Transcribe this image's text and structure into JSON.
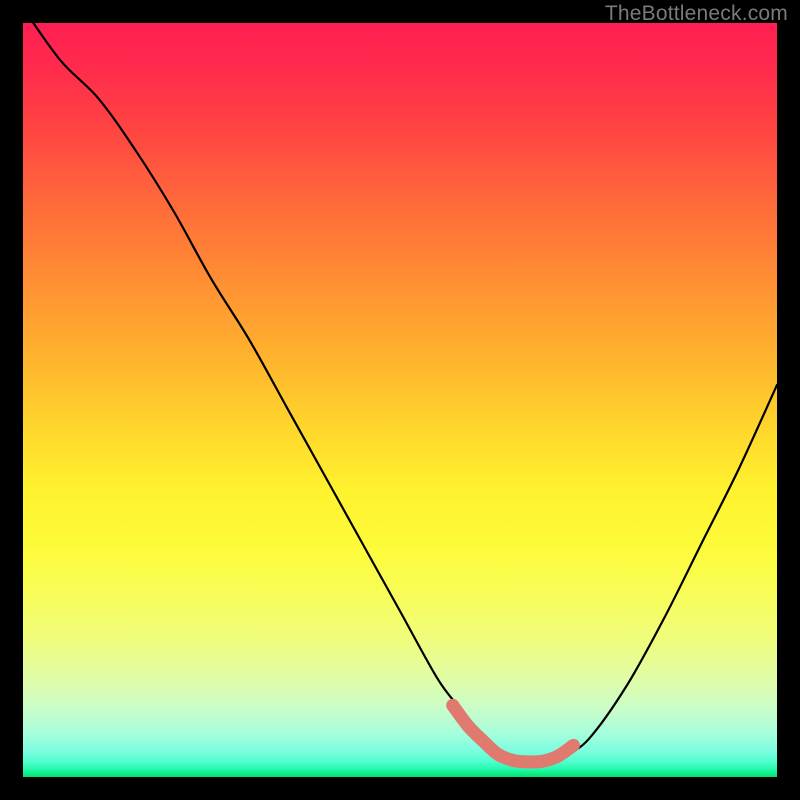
{
  "watermark": "TheBottleneck.com",
  "colors": {
    "background": "#000000",
    "curve_stroke": "#000000",
    "marker_stroke": "#e07a6f",
    "gradient_top": "#ff1f53",
    "gradient_bottom": "#00e36f"
  },
  "chart_data": {
    "type": "line",
    "title": "",
    "xlabel": "",
    "ylabel": "",
    "xlim": [
      0,
      100
    ],
    "ylim": [
      0,
      100
    ],
    "series": [
      {
        "name": "bottleneck-curve",
        "x": [
          0,
          5,
          10,
          15,
          20,
          25,
          30,
          35,
          40,
          45,
          50,
          55,
          58,
          60,
          62,
          64,
          66,
          68,
          70,
          72,
          75,
          80,
          85,
          90,
          95,
          100
        ],
        "values": [
          102,
          95,
          90,
          83,
          75,
          66,
          58,
          49,
          40,
          31,
          22,
          13,
          9,
          6,
          4,
          2.5,
          2,
          2,
          2.2,
          3,
          5,
          12,
          21,
          31,
          41,
          52
        ]
      }
    ],
    "markers": {
      "name": "optimal-range",
      "x": [
        57,
        59,
        61,
        63,
        65,
        67,
        69,
        71,
        73
      ],
      "values": [
        9.5,
        6.8,
        4.8,
        3,
        2.2,
        2,
        2.1,
        2.8,
        4.2
      ]
    }
  }
}
